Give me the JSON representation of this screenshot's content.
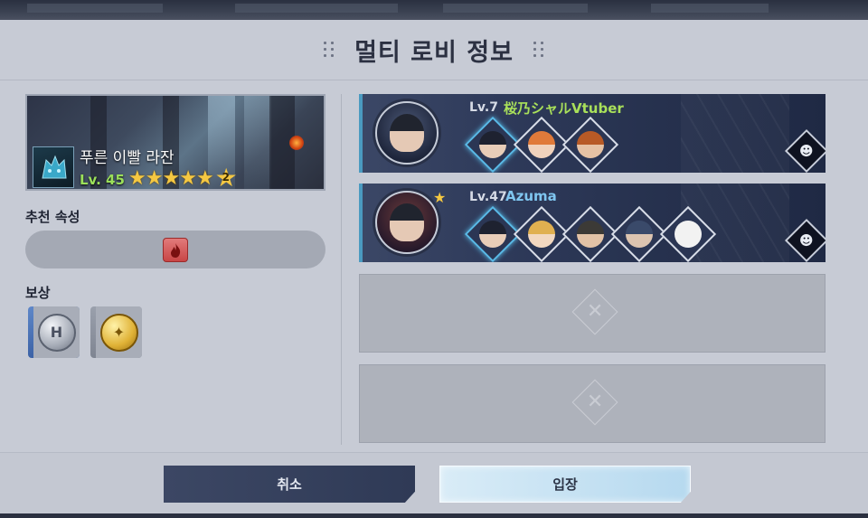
{
  "title": "멀티 로비 정보",
  "boss": {
    "name": "푸른 이빨 라잔",
    "level": "Lv. 45",
    "stars": 5,
    "star_badge": "2"
  },
  "recommended_attribute": {
    "label": "추천 속성",
    "icon": "fire-element-icon",
    "color": "#d24a4a"
  },
  "rewards": {
    "label": "보상",
    "items": [
      {
        "icon": "silver-coin-icon",
        "letter": "H"
      },
      {
        "icon": "gold-coin-icon",
        "letter": "✦"
      }
    ]
  },
  "players": [
    {
      "level": "Lv.7",
      "name": "桜乃シャルVtuber",
      "name_color": "#a9e05a",
      "is_leader": false,
      "heroes": [
        "#2a2f3c",
        "#e07a3a",
        "#c9652e"
      ]
    },
    {
      "level": "Lv.47",
      "name": "Azuma",
      "name_color": "#7fc6f0",
      "is_leader": true,
      "heroes": [
        "#2a2f3c",
        "#e0b050",
        "#3c3a36",
        "#3a4a6a",
        "#f2f2f2"
      ]
    }
  ],
  "empty_slots": 2,
  "buttons": {
    "cancel": "취소",
    "enter": "입장"
  }
}
